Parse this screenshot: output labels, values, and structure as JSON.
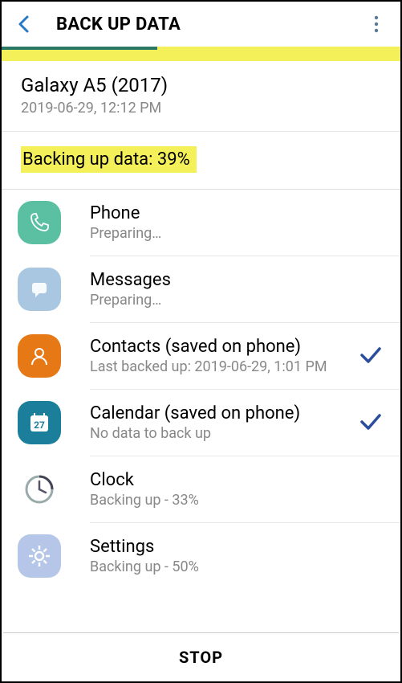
{
  "header": {
    "title": "BACK UP DATA"
  },
  "device": {
    "name": "Galaxy A5 (2017)",
    "timestamp": "2019-06-29, 12:12 PM"
  },
  "status": {
    "text": "Backing up data: 39%"
  },
  "items": [
    {
      "title": "Phone",
      "subtitle": "Preparing…",
      "done": false
    },
    {
      "title": "Messages",
      "subtitle": "Preparing…",
      "done": false
    },
    {
      "title": "Contacts (saved on phone)",
      "subtitle": "Last backed up: 2019-06-29, 1:01 PM",
      "done": true
    },
    {
      "title": "Calendar (saved on phone)",
      "subtitle": "No data to back up",
      "done": true
    },
    {
      "title": "Clock",
      "subtitle": "Backing up - 33%",
      "done": false
    },
    {
      "title": "Settings",
      "subtitle": "Backing up - 50%",
      "done": false
    }
  ],
  "footer": {
    "stop": "STOP"
  }
}
